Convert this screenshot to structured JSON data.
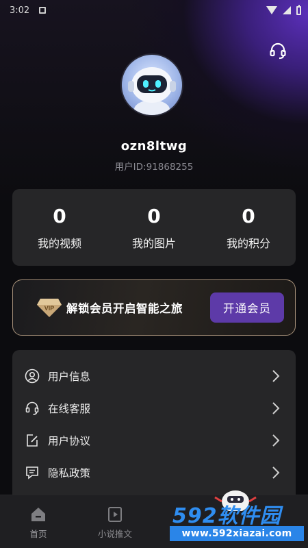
{
  "status_bar": {
    "time": "3:02"
  },
  "profile": {
    "username": "ozn8ltwg",
    "user_id": "用户ID:91868255"
  },
  "stats": [
    {
      "value": "0",
      "label": "我的视频"
    },
    {
      "value": "0",
      "label": "我的图片"
    },
    {
      "value": "0",
      "label": "我的积分"
    }
  ],
  "vip": {
    "badge_text": "VIP",
    "promo": "解锁会员开启智能之旅",
    "button": "开通会员"
  },
  "menu": [
    {
      "label": "用户信息",
      "icon": "user-circle-icon"
    },
    {
      "label": "在线客服",
      "icon": "headset-icon"
    },
    {
      "label": "用户协议",
      "icon": "edit-document-icon"
    },
    {
      "label": "隐私政策",
      "icon": "message-list-icon"
    }
  ],
  "tabs": [
    {
      "label": "首页",
      "icon": "home-icon"
    },
    {
      "label": "小说推文",
      "icon": "play-book-icon"
    }
  ],
  "watermark": {
    "brand": "592软件园",
    "url": "www.592xiazai.com"
  },
  "colors": {
    "accent": "#5d3aa8",
    "card": "#262628",
    "vip_border": "#a8927a"
  }
}
